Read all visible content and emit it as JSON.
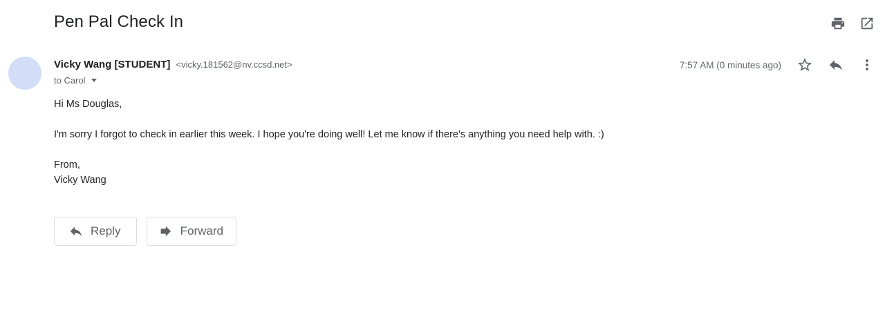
{
  "email": {
    "subject": "Pen Pal Check In",
    "sender_name": "Vicky Wang [STUDENT]",
    "sender_email": "<vicky.181562@nv.ccsd.net>",
    "to_line": "to Carol",
    "timestamp": "7:57 AM (0 minutes ago)",
    "body": {
      "greeting": "Hi Ms Douglas,",
      "paragraph": "I'm sorry I forgot to check in earlier this week. I hope you're doing well! Let me know if there's anything you need help with. :)",
      "closing": "From,",
      "signature": "Vicky Wang"
    }
  },
  "actions": {
    "reply_label": "Reply",
    "forward_label": "Forward"
  },
  "icons": {
    "top": [
      "print-icon",
      "open-in-new-window-icon"
    ],
    "meta": [
      "star-icon",
      "reply-icon",
      "more-vert-icon"
    ]
  },
  "colors": {
    "avatar": "#d2def7",
    "icon_gray": "#5f6368"
  }
}
